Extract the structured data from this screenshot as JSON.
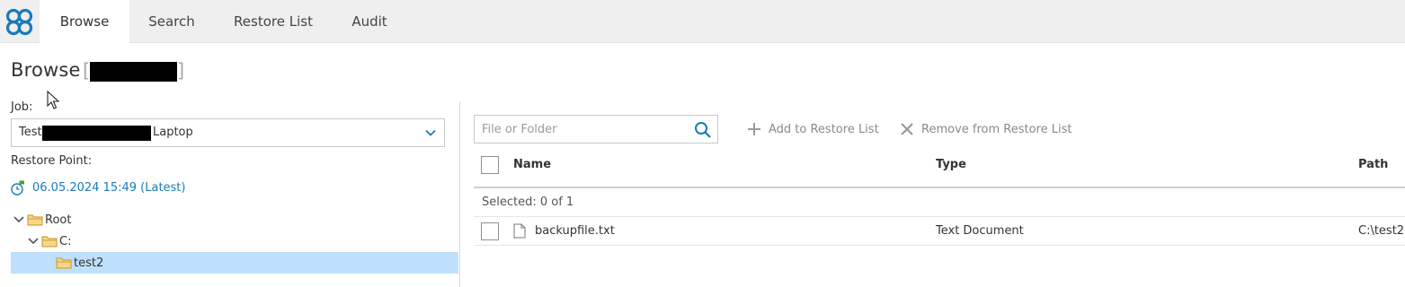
{
  "nav": {
    "logo_icon": "cloud-nodes-logo-icon",
    "tabs": [
      {
        "label": "Browse",
        "active": true
      },
      {
        "label": "Search",
        "active": false
      },
      {
        "label": "Restore List",
        "active": false
      },
      {
        "label": "Audit",
        "active": false
      }
    ]
  },
  "page": {
    "title": "Browse",
    "title_suffix_open": "[",
    "title_suffix_close": "]"
  },
  "left": {
    "job_label": "Job:",
    "job_value_prefix": "Test",
    "job_value_suffix": "Laptop",
    "restore_point_label": "Restore Point:",
    "restore_point_value": "06.05.2024 15:49 (Latest)",
    "tree": [
      {
        "label": "Root",
        "expanded": true,
        "selected": false
      },
      {
        "label": "C:",
        "expanded": true,
        "selected": false
      },
      {
        "label": "test2",
        "expanded": false,
        "selected": true
      }
    ]
  },
  "right": {
    "search_placeholder": "File or Folder",
    "add_label": "Add to Restore List",
    "remove_label": "Remove from Restore List",
    "columns": [
      "Name",
      "Type",
      "Path"
    ],
    "selected_text": "Selected: 0 of 1",
    "rows": [
      {
        "name": "backupfile.txt",
        "type": "Text Document",
        "path": "C:\\test2"
      }
    ]
  },
  "colors": {
    "accent": "#1a7ab9",
    "nav_bg": "#efefef",
    "tree_selected": "#bfe0fb",
    "muted_action": "#8a8a8a"
  }
}
